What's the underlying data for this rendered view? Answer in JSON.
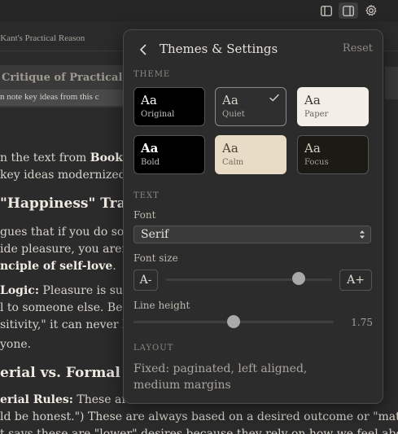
{
  "toolbar": {
    "icons": [
      "sidebar-left-icon",
      "sidebar-right-icon",
      "gear-icon"
    ]
  },
  "document": {
    "title": "g Kant's Practical Reason",
    "highlight_heading": "Critique of Practical Reas",
    "highlight_note": "n note key ideas from this c",
    "lines": [
      {
        "pre": "n the text from ",
        "bold": "Book I,",
        "post": ""
      },
      {
        "pre": "key ideas modernized fo",
        "bold": "",
        "post": ""
      }
    ],
    "heading1": "\"Happiness\" Trap (",
    "para2": [
      {
        "pre": "gues that if you do some",
        "bold": "",
        "post": ""
      },
      {
        "pre": "ide pleasure, you aren't",
        "bold": "",
        "post": ""
      },
      {
        "pre": "",
        "bold": "nciple of self-love",
        "post": "."
      }
    ],
    "para3": [
      {
        "pre": "",
        "bold": "Logic:",
        "post": " Pleasure is subje"
      },
      {
        "pre": "l to someone else. Becau",
        "bold": "",
        "post": ""
      },
      {
        "pre": "sitivity,\" it can never be",
        "bold": "",
        "post": ""
      },
      {
        "pre": "yone.",
        "bold": "",
        "post": ""
      }
    ],
    "heading2": "erial vs. Formal Ru",
    "para4": [
      {
        "pre": "",
        "bold": "erial Rules:",
        "post": " These are \""
      },
      {
        "pre": "ld be honest.\") These are always based on a desired outcome or \"matter.\"",
        "bold": "",
        "post": ""
      },
      {
        "pre": "t says these are \"lower\" desires because they rely on how we feel about",
        "bold": "",
        "post": ""
      }
    ]
  },
  "panel": {
    "title": "Themes & Settings",
    "reset_label": "Reset",
    "theme_section": "THEME",
    "themes": [
      {
        "sample": "Aa",
        "name": "Original",
        "bg": "#000000",
        "fg": "#ffffff",
        "selected": false
      },
      {
        "sample": "Aa",
        "name": "Quiet",
        "bg": "#2f2f2f",
        "fg": "#d8d4cc",
        "selected": true
      },
      {
        "sample": "Aa",
        "name": "Paper",
        "bg": "#f3eee6",
        "fg": "#3a3732",
        "selected": false
      },
      {
        "sample": "Aa",
        "name": "Bold",
        "bg": "#000000",
        "fg": "#ffffff",
        "selected": false
      },
      {
        "sample": "Aa",
        "name": "Calm",
        "bg": "#e9dcc6",
        "fg": "#4a4234",
        "selected": false
      },
      {
        "sample": "Aa",
        "name": "Focus",
        "bg": "#1c1a15",
        "fg": "#d3cdbf",
        "selected": false
      }
    ],
    "text_section": "TEXT",
    "font_label": "Font",
    "font_value": "Serif",
    "font_size_label": "Font size",
    "font_size_decrease": "A-",
    "font_size_increase": "A+",
    "font_size_level": 0.8,
    "line_height_label": "Line height",
    "line_height_value": "1.75",
    "line_height_level": 0.5,
    "layout_section": "LAYOUT",
    "layout_text": "Fixed: paginated, left aligned, medium margins"
  }
}
